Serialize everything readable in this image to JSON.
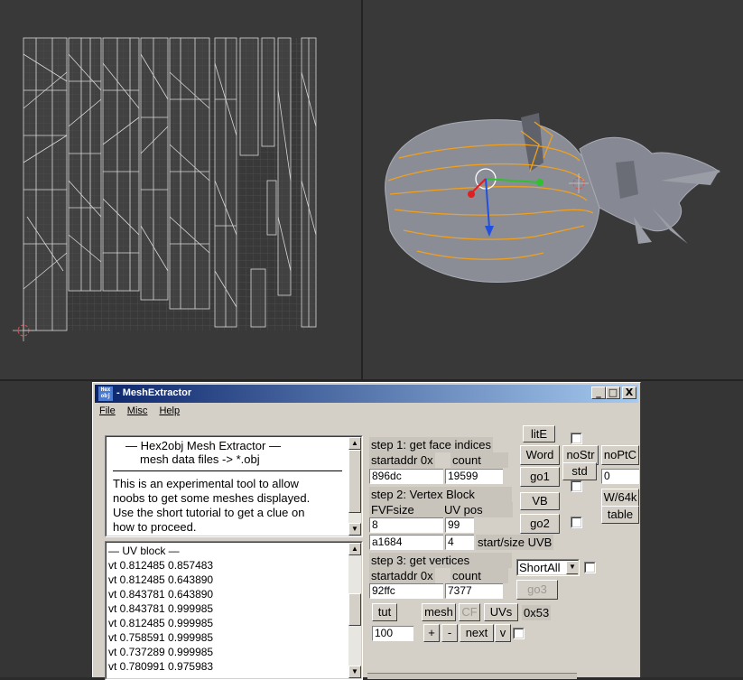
{
  "window": {
    "icon_text": "Hex obj",
    "title": " - MeshExtractor",
    "minimize": "_",
    "maximize": "□",
    "close": "X"
  },
  "menu": [
    "File",
    "Misc",
    "Help"
  ],
  "info": {
    "heading": "— Hex2obj Mesh Extractor —",
    "subheading": "mesh data files -> *.obj",
    "lines": [
      "This is an experimental tool to allow",
      "noobs to get some meshes displayed.",
      "Use the short tutorial to get a clue on",
      "how to proceed."
    ]
  },
  "uv_block": {
    "heading": "— UV block —",
    "rows": [
      "vt 0.812485 0.857483",
      "vt 0.812485 0.643890",
      "vt 0.843781 0.643890",
      "vt 0.843781 0.999985",
      "vt 0.812485 0.999985",
      "vt 0.758591 0.999985",
      "vt 0.737289 0.999985",
      "vt 0.780991 0.975983"
    ]
  },
  "step1": {
    "title": "step 1: get face indices",
    "startaddr_label": "startaddr 0x",
    "count_label": "count",
    "startaddr": "896dc",
    "count": "19599",
    "word_button": "Word",
    "go_button": "go1"
  },
  "step2": {
    "title": "step 2: Vertex Block",
    "fvf_label": "FVFsize",
    "uvpos_label": "UV pos",
    "fvfsize": "8",
    "uvpos": "99",
    "addr": "a1684",
    "size": "4",
    "startsize_label": "start/size UVB",
    "vb_button": "VB",
    "go_button": "go2"
  },
  "step3": {
    "title": "step 3: get vertices",
    "startaddr_label": "startaddr 0x",
    "count_label": "count",
    "startaddr": "92ffc",
    "count": "7377",
    "format_selected": "ShortAll",
    "go_button": "go3"
  },
  "right_buttons": {
    "lite": "litE",
    "nostr": "noStr",
    "noptc": "noPtC",
    "std": "std",
    "field_value": "0",
    "w64k": "W/64k",
    "table": "table"
  },
  "bottom": {
    "tut": "tut",
    "mesh": "mesh",
    "cf": "CF",
    "uvs": "UVs",
    "hex_value": "0x53",
    "step_value": "100",
    "plus": "+",
    "minus": "-",
    "next": "next",
    "v": "v"
  },
  "colors": {
    "title_gradient_start": "#0a246a",
    "title_gradient_end": "#a6caf0",
    "dialog_face": "#d4d0c8",
    "selection_orange": "#f0a020",
    "mesh_grey": "#8a8d96"
  }
}
